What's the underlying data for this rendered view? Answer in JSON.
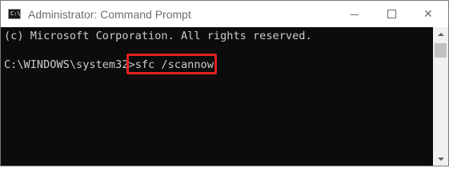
{
  "window": {
    "title": "Administrator: Command Prompt",
    "icon_name": "command-prompt-icon",
    "icon_glyph": "C:\\"
  },
  "console": {
    "copyright_line": "(c) Microsoft Corporation. All rights reserved.",
    "prompt": "C:\\WINDOWS\\system32>",
    "command": "sfc /scannow"
  },
  "controls": {
    "minimize_icon": "minimize-icon",
    "maximize_icon": "maximize-icon",
    "close_icon": "close-icon",
    "close_glyph": "✕"
  },
  "colors": {
    "highlight": "#e02020",
    "console_bg": "#0c0c0c",
    "console_text": "#cccccc"
  }
}
